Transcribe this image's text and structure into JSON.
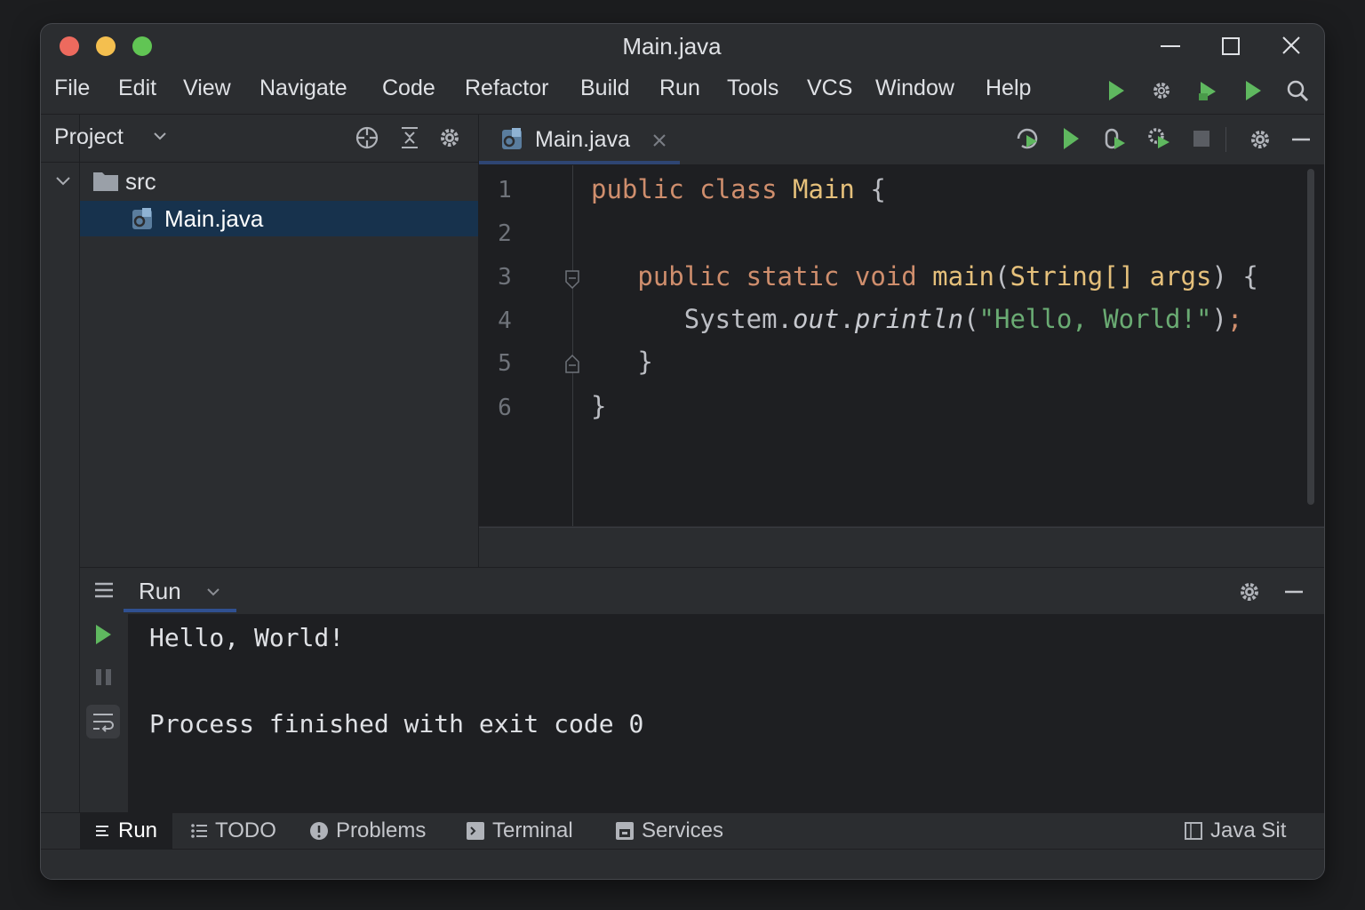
{
  "window": {
    "title": "Main.java",
    "traffic_lights": [
      "#ed6a5e",
      "#f4bf4f",
      "#61c554"
    ]
  },
  "menu": {
    "items": [
      "File",
      "Edit",
      "View",
      "Navigate",
      "Code",
      "Refactor",
      "Build",
      "Run",
      "Tools",
      "VCS",
      "Window",
      "Help"
    ]
  },
  "project": {
    "header_label": "Project",
    "tree": {
      "folder": "src",
      "file": "Main.java"
    }
  },
  "editor": {
    "tab_label": "Main.java",
    "line_numbers": [
      "1",
      "2",
      "3",
      "4",
      "5",
      "6"
    ],
    "code": {
      "l1_kw1": "public",
      "l1_kw2": "class",
      "l1_cls": "Main",
      "l1_brace": "{",
      "l3_kw1": "public",
      "l3_kw2": "static",
      "l3_kw3": "void",
      "l3_method": "main",
      "l3_paren_open": "(",
      "l3_type": "String[]",
      "l3_param": "args",
      "l3_tail": ") {",
      "l4_obj": "System.",
      "l4_field": "out",
      "l4_dot": ".",
      "l4_method": "println",
      "l4_paren": "(",
      "l4_str": "\"Hello, World!\"",
      "l4_close": ")",
      "l4_semi": ";",
      "l5": "}",
      "l6": "}"
    }
  },
  "run_panel": {
    "tab_label": "Run",
    "output": [
      "Hello, World!",
      "Process finished with exit code 0"
    ]
  },
  "bottom_tabs": {
    "run": "Run",
    "todo": "TODO",
    "problems": "Problems",
    "terminal": "Terminal",
    "services": "Services",
    "java_sit": "Java Sit"
  },
  "colors": {
    "accent_green": "#5fb85f",
    "keyword": "#cf8e6d",
    "class_name": "#e5c07b",
    "string": "#6aab73",
    "selection": "#17324d"
  },
  "icons": {
    "toolbar": [
      "run-icon",
      "settings-icon",
      "build-icon",
      "run-icon",
      "search-icon"
    ],
    "editor_toolbar": [
      "rerun-icon",
      "run-icon",
      "debug-icon",
      "build-icon",
      "stop-icon",
      "settings-icon",
      "minimize-icon"
    ]
  }
}
